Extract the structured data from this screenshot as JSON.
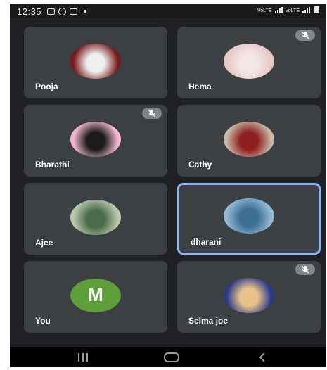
{
  "status_bar": {
    "time": "12:35",
    "network_labels": [
      "VoLTE",
      "VoLTE"
    ]
  },
  "participants": [
    {
      "name": "Pooja",
      "muted": false,
      "avatar": "teddy-bear-photo",
      "colors": [
        "#7a1a1a",
        "#efefef"
      ]
    },
    {
      "name": "Hema",
      "muted": true,
      "avatar": "doll-photo",
      "colors": [
        "#e7c7c4",
        "#f2e6e6"
      ]
    },
    {
      "name": "Bharathi",
      "muted": true,
      "avatar": "minnie-mouse-photo",
      "colors": [
        "#f3b8d0",
        "#1c1c1c"
      ]
    },
    {
      "name": "Cathy",
      "muted": false,
      "avatar": "figurine-photo",
      "colors": [
        "#c9b8a6",
        "#8f1f1f"
      ]
    },
    {
      "name": "Ajee",
      "muted": false,
      "avatar": "forest-photo",
      "colors": [
        "#b8c9b0",
        "#4c6b4a"
      ]
    },
    {
      "name": "dharani",
      "muted": false,
      "avatar": "dolphins-photo",
      "colors": [
        "#93b9d6",
        "#3d6f95"
      ],
      "active": true
    },
    {
      "name": "You",
      "muted": false,
      "avatar_letter": "M",
      "avatar_color": "#5f9f3a"
    },
    {
      "name": "Selma joe",
      "muted": true,
      "avatar": "night-beach-photo",
      "colors": [
        "#2a3a8a",
        "#e7c28a"
      ]
    }
  ],
  "colors": {
    "screen_bg": "#202124",
    "tile_bg": "#3c4043",
    "active_border": "#8ab4f8",
    "mute_badge": "#80868b"
  },
  "nav_icons": [
    "recent-apps-icon",
    "home-icon",
    "back-icon"
  ]
}
